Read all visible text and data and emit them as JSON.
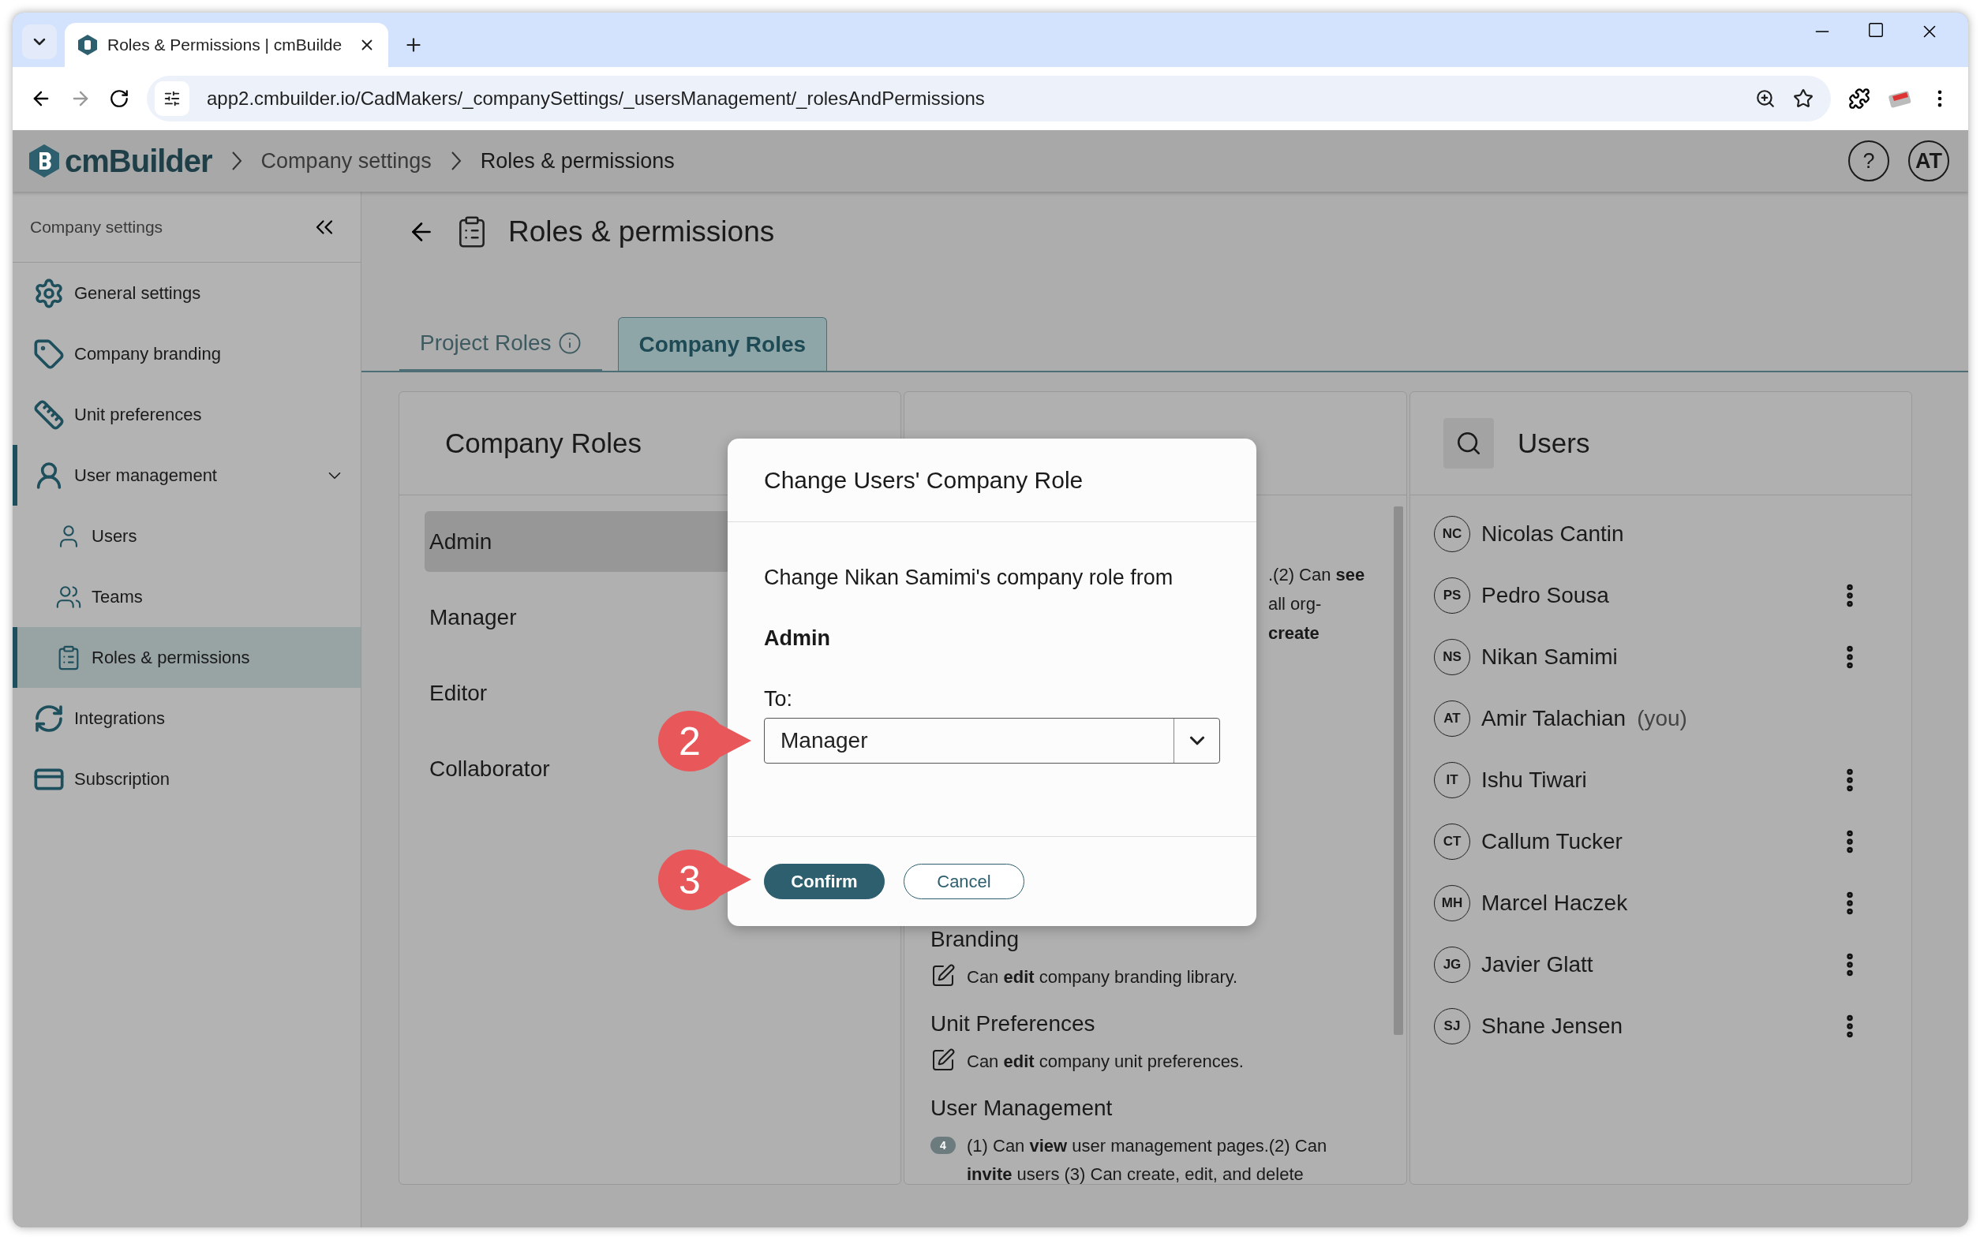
{
  "browser": {
    "tab_title": "Roles & Permissions | cmBuilde",
    "url": "app2.cmbuilder.io/CadMakers/_companySettings/_usersManagement/_rolesAndPermissions"
  },
  "app_header": {
    "logo": "cmBuilder",
    "breadcrumbs": [
      {
        "label": "Company settings",
        "current": false
      },
      {
        "label": "Roles & permissions",
        "current": true
      }
    ],
    "help": "?",
    "avatar": "AT"
  },
  "sidebar": {
    "title": "Company settings",
    "items": [
      {
        "label": "General settings",
        "selected": false
      },
      {
        "label": "Company branding",
        "selected": false
      },
      {
        "label": "Unit preferences",
        "selected": false
      },
      {
        "label": "User management",
        "selected": false,
        "expanded": true,
        "children": [
          {
            "label": "Users",
            "selected": false
          },
          {
            "label": "Teams",
            "selected": false
          },
          {
            "label": "Roles & permissions",
            "selected": true
          }
        ]
      },
      {
        "label": "Integrations",
        "selected": false
      },
      {
        "label": "Subscription",
        "selected": false
      }
    ]
  },
  "page": {
    "title": "Roles & permissions",
    "tabs": [
      {
        "label": "Project Roles",
        "selected": false,
        "info": true
      },
      {
        "label": "Company Roles",
        "selected": true,
        "info": false
      }
    ]
  },
  "roles_panel": {
    "title": "Company Roles",
    "roles": [
      {
        "label": "Admin",
        "selected": true
      },
      {
        "label": "Manager",
        "selected": false
      },
      {
        "label": "Editor",
        "selected": false
      },
      {
        "label": "Collaborator",
        "selected": false
      }
    ]
  },
  "permissions_panel": {
    "fragments": [
      ".(2) Can **see**",
      "all org-",
      "**create**"
    ],
    "sections": [
      {
        "title": "Branding",
        "kind": "edit",
        "text": "Can **edit** company branding library."
      },
      {
        "title": "Unit Preferences",
        "kind": "edit",
        "text": "Can **edit** company unit preferences."
      },
      {
        "title": "User Management",
        "kind": "level",
        "badge": "4",
        "text": "(1) Can **view** user management pages.(2) Can **invite** users (3) Can create, edit, and delete"
      }
    ]
  },
  "users_panel": {
    "title": "Users",
    "users": [
      {
        "initials": "NC",
        "name": "Nicolas Cantin",
        "menu": false
      },
      {
        "initials": "PS",
        "name": "Pedro Sousa",
        "menu": true
      },
      {
        "initials": "NS",
        "name": "Nikan Samimi",
        "menu": true
      },
      {
        "initials": "AT",
        "name": "Amir Talachian",
        "suffix": "(you)",
        "menu": false
      },
      {
        "initials": "IT",
        "name": "Ishu Tiwari",
        "menu": true
      },
      {
        "initials": "CT",
        "name": "Callum Tucker",
        "menu": true
      },
      {
        "initials": "MH",
        "name": "Marcel Haczek",
        "menu": true
      },
      {
        "initials": "JG",
        "name": "Javier Glatt",
        "menu": true
      },
      {
        "initials": "SJ",
        "name": "Shane Jensen",
        "menu": true
      }
    ]
  },
  "dialog": {
    "title": "Change Users' Company Role",
    "message": "Change Nikan Samimi's company role from",
    "from_role": "Admin",
    "to_label": "To:",
    "to_value": "Manager",
    "buttons": [
      {
        "label": "Confirm",
        "kind": "primary"
      },
      {
        "label": "Cancel",
        "kind": "secondary"
      }
    ]
  },
  "markers": [
    {
      "label": "2"
    },
    {
      "label": "3"
    }
  ]
}
